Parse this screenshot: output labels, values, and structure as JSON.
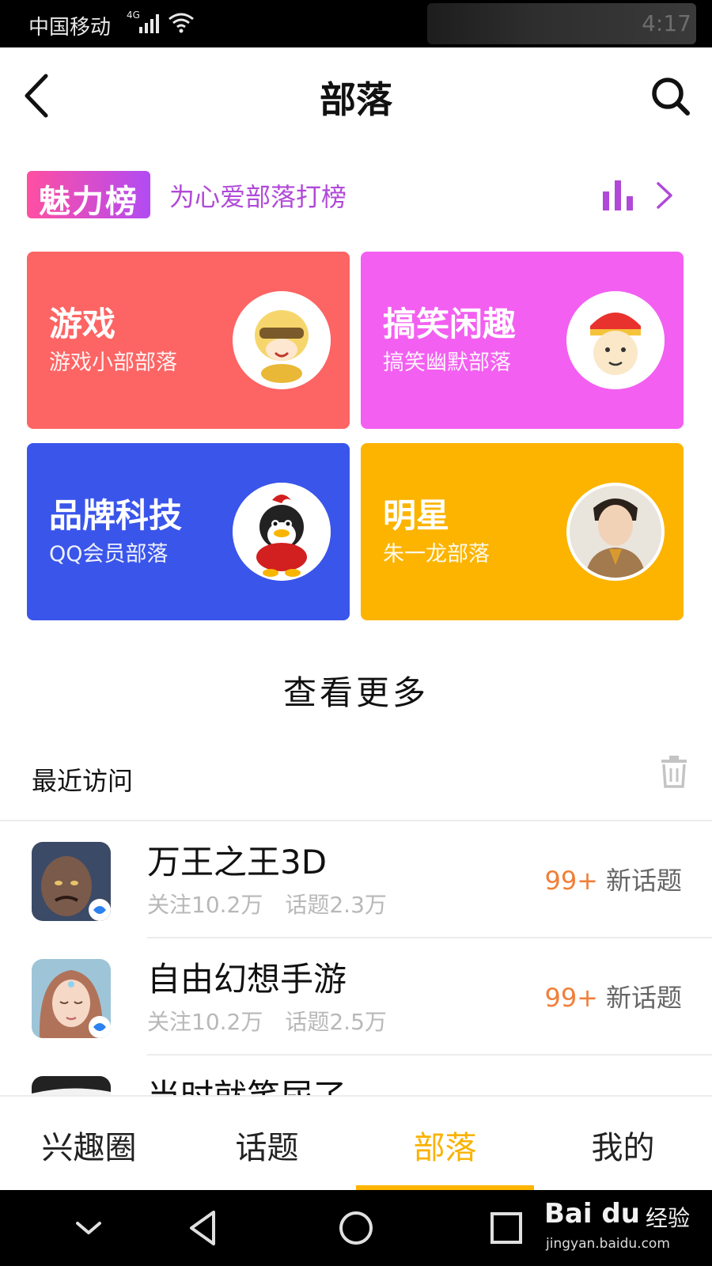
{
  "status_bar": {
    "carrier": "中国移动",
    "network": "4G",
    "time": "4:17"
  },
  "header": {
    "title": "部落",
    "back_icon": "chevron-left-icon",
    "search_icon": "search-icon"
  },
  "charm_rank": {
    "logo_text": "魅力榜",
    "slogan": "为心爱部落打榜",
    "chart_icon": "bar-chart-icon",
    "arrow_icon": "chevron-right-icon",
    "color": "#b049d8"
  },
  "categories": [
    {
      "title": "游戏",
      "subtitle": "游戏小部部落",
      "color": "#fd6464",
      "avatar": "anime-girl-avatar"
    },
    {
      "title": "搞笑闲趣",
      "subtitle": "搞笑幽默部落",
      "color": "#f35ff1",
      "avatar": "funny-face-avatar"
    },
    {
      "title": "品牌科技",
      "subtitle": "QQ会员部落",
      "color": "#3a55ea",
      "avatar": "qq-penguin-avatar"
    },
    {
      "title": "明星",
      "subtitle": "朱一龙部落",
      "color": "#fcb400",
      "avatar": "celebrity-avatar"
    }
  ],
  "view_more": "查看更多",
  "recent": {
    "label": "最近访问",
    "trash_icon": "trash-icon",
    "items": [
      {
        "name": "万王之王3D",
        "followers": "关注10.2万",
        "topics": "话题2.3万",
        "badge_count": "99+",
        "badge_text": "新话题"
      },
      {
        "name": "自由幻想手游",
        "followers": "关注10.2万",
        "topics": "话题2.5万",
        "badge_count": "99+",
        "badge_text": "新话题"
      },
      {
        "name": "当时就笑尿了",
        "followers": "",
        "topics": "",
        "badge_count": "",
        "badge_text": ""
      }
    ]
  },
  "tabs": [
    {
      "label": "兴趣圈",
      "active": false
    },
    {
      "label": "话题",
      "active": false
    },
    {
      "label": "部落",
      "active": true
    },
    {
      "label": "我的",
      "active": false
    }
  ],
  "accent_color": "#ffb400",
  "nav_bar": {
    "buttons": [
      "chevron-down-icon",
      "back-triangle-icon",
      "home-circle-icon",
      "recents-square-icon"
    ]
  },
  "watermark": {
    "brand": "Bai du",
    "suffix": "经验",
    "url": "jingyan.baidu.com"
  }
}
